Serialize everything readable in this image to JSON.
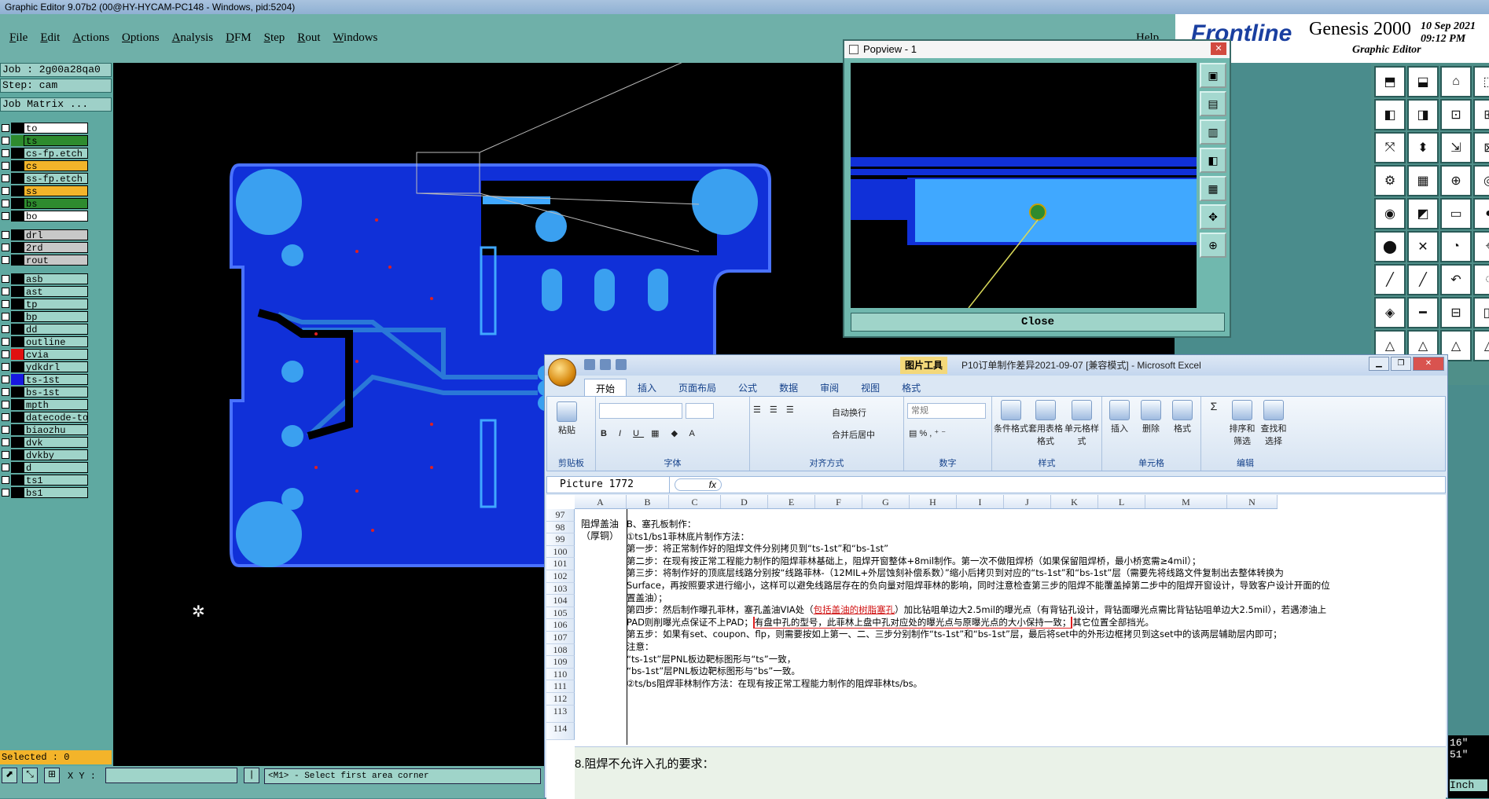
{
  "window": {
    "title": "Graphic Editor 9.07b2 (00@HY-HYCAM-PC148 - Windows, pid:5204)"
  },
  "menu": {
    "items": [
      "File",
      "Edit",
      "Actions",
      "Options",
      "Analysis",
      "DFM",
      "Step",
      "Rout",
      "Windows"
    ],
    "help": "Help"
  },
  "brand": {
    "logo": "Frontline",
    "product": "Genesis 2000",
    "subtitle": "Graphic Editor",
    "date": "10 Sep 2021",
    "time": "09:12 PM"
  },
  "job": {
    "job": "Job : 2g00a28qa0",
    "step": "Step: cam",
    "matrix": "Job Matrix ..."
  },
  "layers": [
    {
      "name": "to",
      "color": "#000000",
      "box": "#ffffff"
    },
    {
      "name": "ts",
      "color": "#2e8b2e",
      "box": "#2e8b2e"
    },
    {
      "name": "cs-fp.etch",
      "color": "#000000",
      "box": "#9fd4c9"
    },
    {
      "name": "cs",
      "color": "#000000",
      "box": "#f3b42a"
    },
    {
      "name": "ss-fp.etch",
      "color": "#000000",
      "box": "#9fd4c9"
    },
    {
      "name": "ss",
      "color": "#000000",
      "box": "#f3b42a"
    },
    {
      "name": "bs",
      "color": "#000000",
      "box": "#2e8b2e"
    },
    {
      "name": "bo",
      "color": "#000000",
      "box": "#ffffff"
    },
    {
      "name": "drl",
      "color": "#000000",
      "box": "#c8c8c8"
    },
    {
      "name": "2rd",
      "color": "#000000",
      "box": "#c8c8c8"
    },
    {
      "name": "rout",
      "color": "#000000",
      "box": "#c8c8c8"
    },
    {
      "name": "asb",
      "color": "#000000",
      "box": "#9fd4c9"
    },
    {
      "name": "ast",
      "color": "#000000",
      "box": "#9fd4c9"
    },
    {
      "name": "tp",
      "color": "#000000",
      "box": "#9fd4c9"
    },
    {
      "name": "bp",
      "color": "#000000",
      "box": "#9fd4c9"
    },
    {
      "name": "dd",
      "color": "#000000",
      "box": "#9fd4c9"
    },
    {
      "name": "outline",
      "color": "#000000",
      "box": "#9fd4c9"
    },
    {
      "name": "cvia",
      "color": "#e01010",
      "box": "#9fd4c9"
    },
    {
      "name": "ydkdrl",
      "color": "#000000",
      "box": "#9fd4c9"
    },
    {
      "name": "ts-1st",
      "color": "#1818e0",
      "box": "#9fd4c9"
    },
    {
      "name": "bs-1st",
      "color": "#000000",
      "box": "#9fd4c9"
    },
    {
      "name": "mpth",
      "color": "#000000",
      "box": "#9fd4c9"
    },
    {
      "name": "datecode-to",
      "color": "#000000",
      "box": "#9fd4c9"
    },
    {
      "name": "biaozhu",
      "color": "#000000",
      "box": "#9fd4c9"
    },
    {
      "name": "dvk",
      "color": "#000000",
      "box": "#9fd4c9"
    },
    {
      "name": "dvkby",
      "color": "#000000",
      "box": "#9fd4c9"
    },
    {
      "name": "d",
      "color": "#000000",
      "box": "#9fd4c9"
    },
    {
      "name": "ts1",
      "color": "#000000",
      "box": "#9fd4c9"
    },
    {
      "name": "bs1",
      "color": "#000000",
      "box": "#9fd4c9"
    }
  ],
  "status": {
    "selected": "Selected : 0",
    "xy_label": "X Y :",
    "prompt": "<M1> - Select first area corner",
    "units": "Inch",
    "coord1": "16\"",
    "coord2": "51\""
  },
  "popview": {
    "title": "Popview - 1",
    "close": "Close"
  },
  "excel": {
    "doc_title": "P10订单制作差异2021-09-07 [兼容模式] - Microsoft Excel",
    "tool_tab": "图片工具",
    "tabs": [
      "开始",
      "插入",
      "页面布局",
      "公式",
      "数据",
      "审阅",
      "视图",
      "格式"
    ],
    "groups": [
      "剪贴板",
      "字体",
      "对齐方式",
      "数字",
      "样式",
      "单元格",
      "编辑"
    ],
    "buttons": {
      "paste": "粘贴",
      "wrap": "自动换行",
      "merge": "合并后居中",
      "number_format": "常规",
      "cond": "条件格式",
      "table": "套用表格格式",
      "cellstyle": "单元格样式",
      "insert": "插入",
      "delete": "删除",
      "format": "格式",
      "sort": "排序和筛选",
      "find": "查找和选择"
    },
    "namebox": "Picture 1772",
    "fx": "fx",
    "columns": [
      "A",
      "B",
      "C",
      "D",
      "E",
      "F",
      "G",
      "H",
      "I",
      "J",
      "K",
      "L",
      "M",
      "N"
    ],
    "rows": [
      "97",
      "98",
      "99",
      "100",
      "101",
      "102",
      "103",
      "104",
      "105",
      "106",
      "107",
      "108",
      "109",
      "110",
      "111",
      "112",
      "113",
      "114"
    ],
    "cellA": "阻焊盖油（厚铜）",
    "lines": [
      "B、塞孔板制作：",
      "①ts1/bs1菲林底片制作方法：",
      "第一步：将正常制作好的阻焊文件分别拷贝到“ts-1st”和“bs-1st”",
      "第二步：在现有按正常工程能力制作的阻焊菲林基础上，阻焊开窗整体+8mil制作。第一次不做阻焊桥（如果保留阻焊桥，最小桥宽需≥4mil）；",
      "第三步：将制作好的顶底层线路分别按“线路菲林-（12MIL+外层蚀刻补偿系数）”缩小后拷贝到对应的“ts-1st”和“bs-1st”层（需要先将线路文件复制出去整体转换为",
      "Surface，再按照要求进行缩小，这样可以避免线路层存在的负向量对阻焊菲林的影响，同时注意检查第三步的阻焊不能覆盖掉第二步中的阻焊开窗设计，导致客户设计开面的位",
      "置盖油）；",
      "第四步：然后制作曝孔菲林，塞孔盖油VIA处（包括盖油的树脂塞孔）加比钻咀单边大2.5mil的曝光点（有背钻孔设计，背钻面曝光点需比背钻钻咀单边大2.5mil），若遇渗油上",
      "PAD则削曝光点保证不上PAD；有盘中孔的型号，此菲林上盘中孔对应处的曝光点与原曝光点的大小保持一致；其它位置全部挡光。",
      "第五步：如果有set、coupon、flp，则需要按如上第一、二、三步分别制作“ts-1st”和“bs-1st”层，最后将set中的外形边框拷贝到这set中的该两层辅助层内即可；",
      "注意：",
      "“ts-1st”层PNL板边靶标图形与“ts”一致，",
      "“bs-1st”层PNL板边靶标图形与“bs”一致。",
      "②ts/bs阻焊菲林制作方法：在现有按正常工程能力制作的阻焊菲林ts/bs。"
    ],
    "line7_pre": "第四步：然后制作曝孔菲林，塞孔盖油VIA处（",
    "line7_red": "包括盖油的树脂塞孔",
    "line7_post": "）加比钻咀单边大2.5mil的曝光点（有背钻孔设计，背钻面曝光点需比背钻钻咀单边大2.5mil），若遇渗油上",
    "line8_pre": "PAD则削曝光点保证不上PAD；",
    "line8_box": "有盘中孔的型号，此菲林上盘中孔对应处的曝光点与原曝光点的大小保持一致；",
    "line8_post": "其它位置全部挡光。",
    "row113": "8.阻焊不允许入孔的要求："
  }
}
